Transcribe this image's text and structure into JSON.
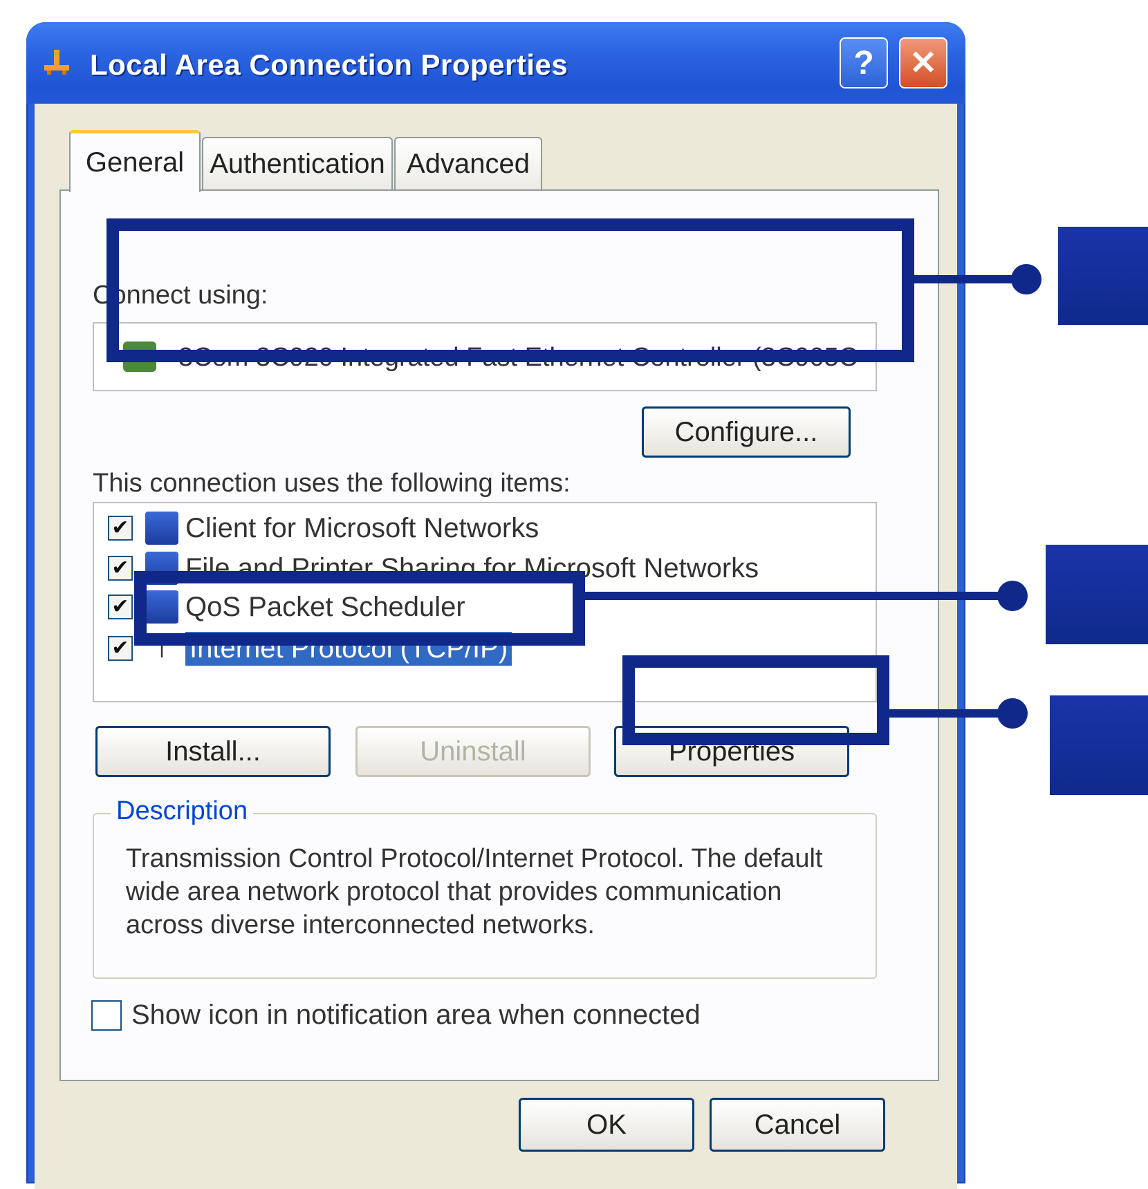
{
  "window": {
    "title": "Local Area Connection Properties",
    "help_label": "?",
    "close_label": "✕"
  },
  "tabs": [
    {
      "label": "General",
      "active": true
    },
    {
      "label": "Authentication",
      "active": false
    },
    {
      "label": "Advanced",
      "active": false
    }
  ],
  "general": {
    "connect_using_label": "Connect using:",
    "adapter_name": "3Com 3C920 Integrated Fast Ethernet Controller (3C905C-",
    "configure_label": "Configure...",
    "items_label": "This connection uses the following items:",
    "items": [
      {
        "label": "Client for Microsoft Networks",
        "checked": true,
        "selected": false,
        "icon": "network-client-icon"
      },
      {
        "label": "File and Printer Sharing for Microsoft Networks",
        "checked": true,
        "selected": false,
        "icon": "file-printer-sharing-icon"
      },
      {
        "label": "QoS Packet Scheduler",
        "checked": true,
        "selected": false,
        "icon": "qos-scheduler-icon"
      },
      {
        "label": "Internet Protocol (TCP/IP)",
        "checked": true,
        "selected": true,
        "icon": "protocol-icon"
      }
    ],
    "install_label": "Install...",
    "uninstall_label": "Uninstall",
    "properties_label": "Properties",
    "description_label": "Description",
    "description_text": "Transmission Control Protocol/Internet Protocol. The default wide area network protocol that provides communication across diverse interconnected networks.",
    "show_icon_label": "Show icon in notification area when connected",
    "show_icon_checked": false
  },
  "footer": {
    "ok_label": "OK",
    "cancel_label": "Cancel"
  },
  "colors": {
    "titlebar": "#2a63e0",
    "callout": "#10288a",
    "selection": "#316ac5"
  }
}
